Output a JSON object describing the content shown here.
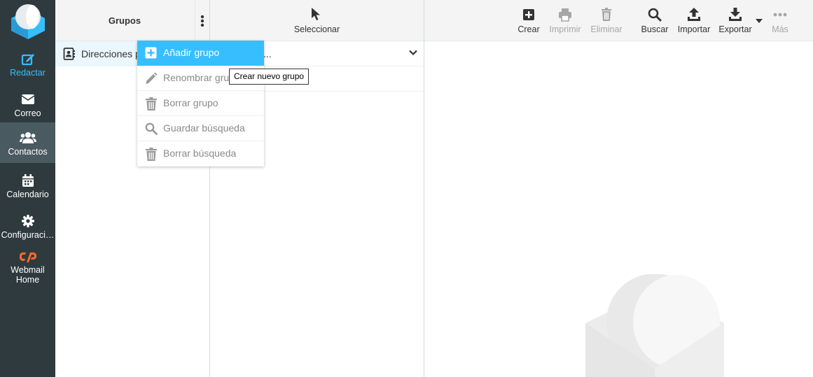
{
  "nav": {
    "items": [
      {
        "label": "Redactar",
        "icon": "compose-icon"
      },
      {
        "label": "Correo",
        "icon": "envelope-icon"
      },
      {
        "label": "Contactos",
        "icon": "users-icon"
      },
      {
        "label": "Calendario",
        "icon": "calendar-icon"
      },
      {
        "label": "Configuraci…",
        "icon": "gear-icon"
      },
      {
        "label": "Webmail",
        "label2": "Home",
        "icon": "cpanel-icon"
      }
    ]
  },
  "groups": {
    "title": "Grupos",
    "addressbook": "Direcciones p"
  },
  "list": {
    "select_label": "Seleccionar",
    "row_text": "..."
  },
  "toolbar": {
    "create": "Crear",
    "print": "Imprimir",
    "delete": "Eliminar",
    "search": "Buscar",
    "import": "Importar",
    "export": "Exportar",
    "more": "Más"
  },
  "dropdown": {
    "items": [
      {
        "label": "Añadir grupo",
        "icon": "plus-square-icon"
      },
      {
        "label": "Renombrar gru",
        "icon": "pencil-icon"
      },
      {
        "label": "Borrar grupo",
        "icon": "trash-icon"
      },
      {
        "label": "Guardar búsqueda",
        "icon": "search-icon"
      },
      {
        "label": "Borrar búsqueda",
        "icon": "trash-icon"
      }
    ],
    "tooltip": "Crear nuevo grupo"
  },
  "colors": {
    "nav_bg": "#2f3a3f",
    "accent": "#37beff",
    "cpanel": "#ff6c2c"
  }
}
